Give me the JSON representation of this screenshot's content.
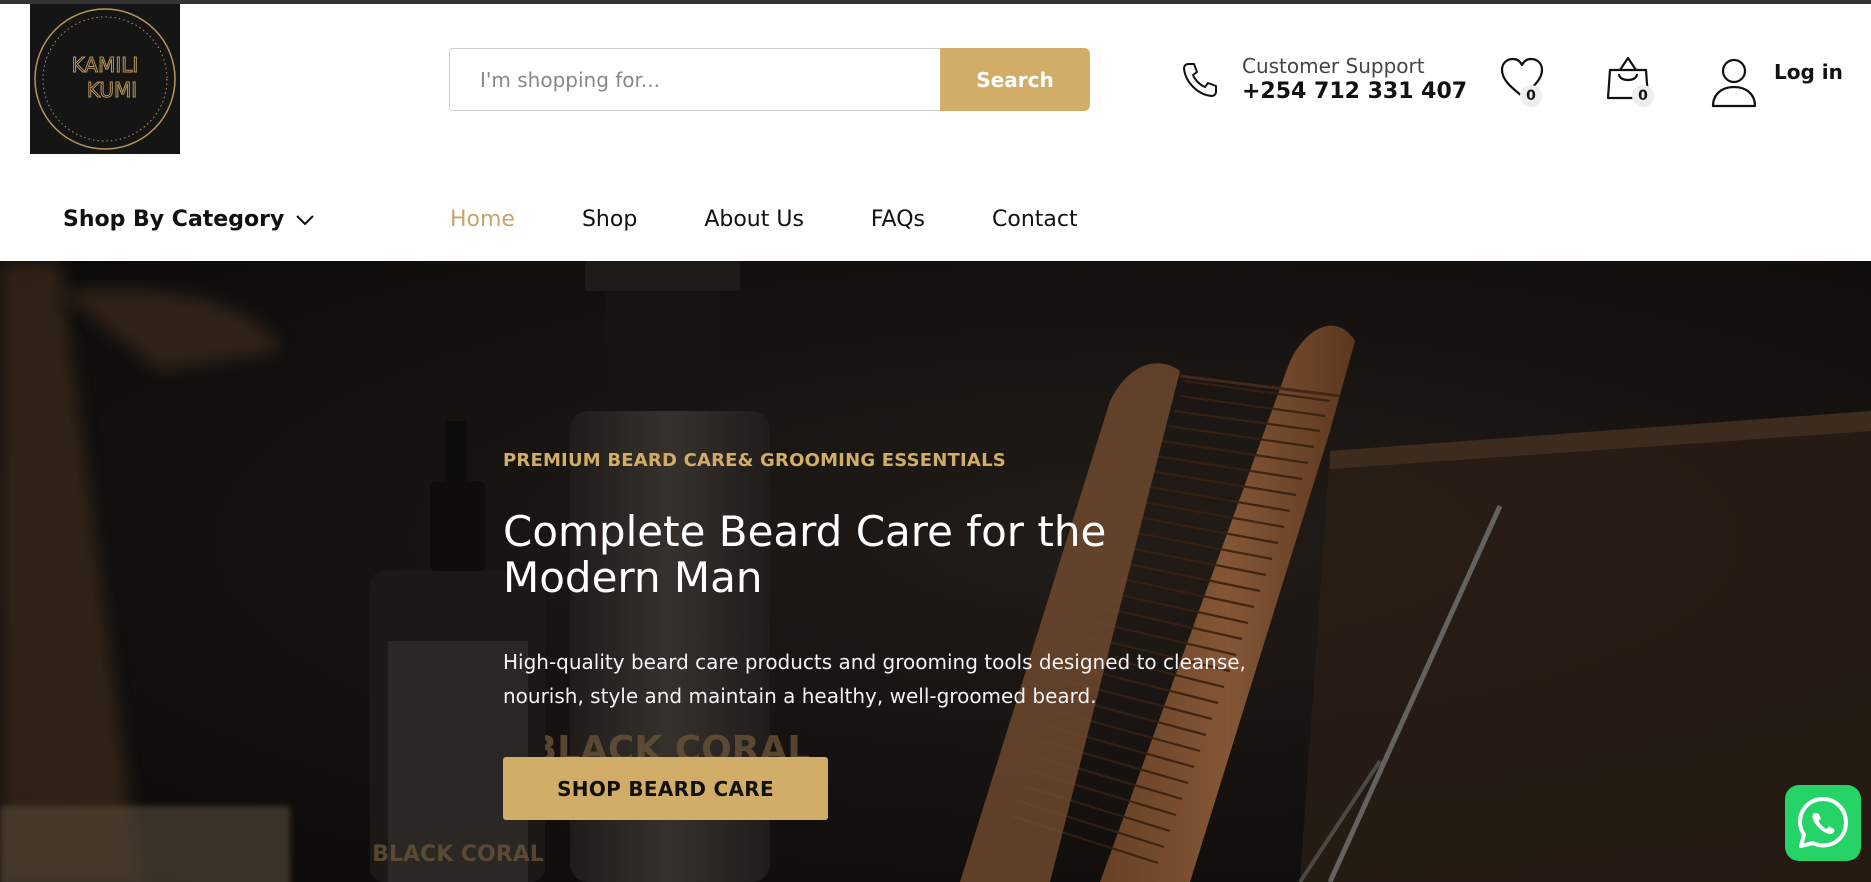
{
  "brand": {
    "logo_line1": "KAMILI",
    "logo_line2": "KUMI",
    "accent_color": "#d1ad68",
    "logo_bg": "#151515"
  },
  "search": {
    "placeholder": "I'm shopping for...",
    "button_label": "Search",
    "icon": "search"
  },
  "support": {
    "icon": "phone-icon",
    "label": "Customer Support",
    "number": "+254 712 331 407"
  },
  "header_actions": {
    "wishlist_icon": "heart-icon",
    "wishlist_count": "0",
    "cart_icon": "shopping-bag-icon",
    "cart_count": "0",
    "login_icon": "user-icon",
    "login_label": "Log in"
  },
  "nav": {
    "category_label": "Shop By Category",
    "category_icon": "chevron-down-icon",
    "links": [
      {
        "label": "Home",
        "active": true
      },
      {
        "label": "Shop",
        "active": false
      },
      {
        "label": "About Us",
        "active": false
      },
      {
        "label": "FAQs",
        "active": false
      },
      {
        "label": "Contact",
        "active": false
      }
    ]
  },
  "hero": {
    "eyebrow": "PREMIUM BEARD CARE& GROOMING ESSENTIALS",
    "title": "Complete Beard Care for the Modern Man",
    "text": "High-quality beard care products and grooming tools designed to cleanse, nourish, style and maintain a healthy, well-groomed beard.",
    "cta_label": "SHOP BEARD CARE",
    "product_label_1": "BLACK CORAL",
    "product_label_2": "BLACK CORAL"
  },
  "floating": {
    "whatsapp_icon": "whatsapp-icon",
    "whatsapp_color": "#25d366"
  }
}
